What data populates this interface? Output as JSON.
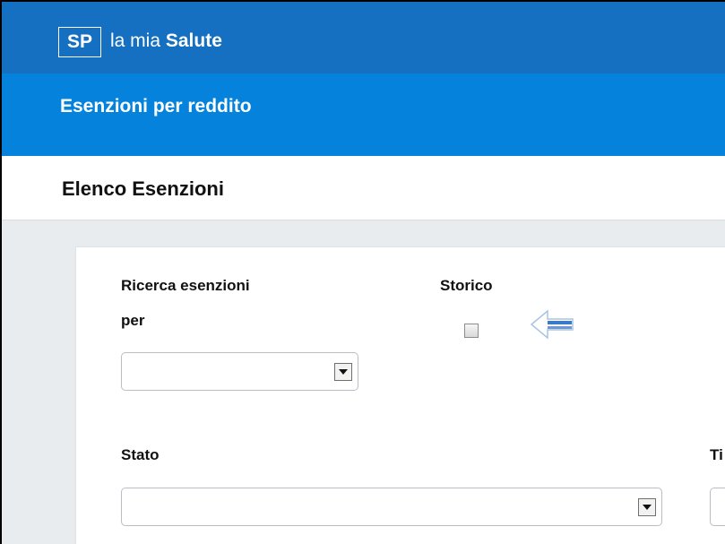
{
  "app": {
    "logo_text": "SP",
    "brand_prefix": "la mia",
    "brand_name": "Salute"
  },
  "section_bar": {
    "title": "Esenzioni per reddito"
  },
  "page": {
    "title": "Elenco Esenzioni"
  },
  "form": {
    "search_by_label_line1": "Ricerca esenzioni",
    "search_by_label_line2": "per",
    "search_by_value": "",
    "storico_label": "Storico",
    "storico_checked": false,
    "back_icon": "back-arrow-icon",
    "stato_label": "Stato",
    "stato_value": "",
    "tipo_label_partial": "Ti",
    "tipo_value": ""
  },
  "colors": {
    "top_bar": "#1570c1",
    "section_bar": "#0482dc",
    "background": "#e8ecef",
    "arrow_blue": "#3b79c9"
  }
}
